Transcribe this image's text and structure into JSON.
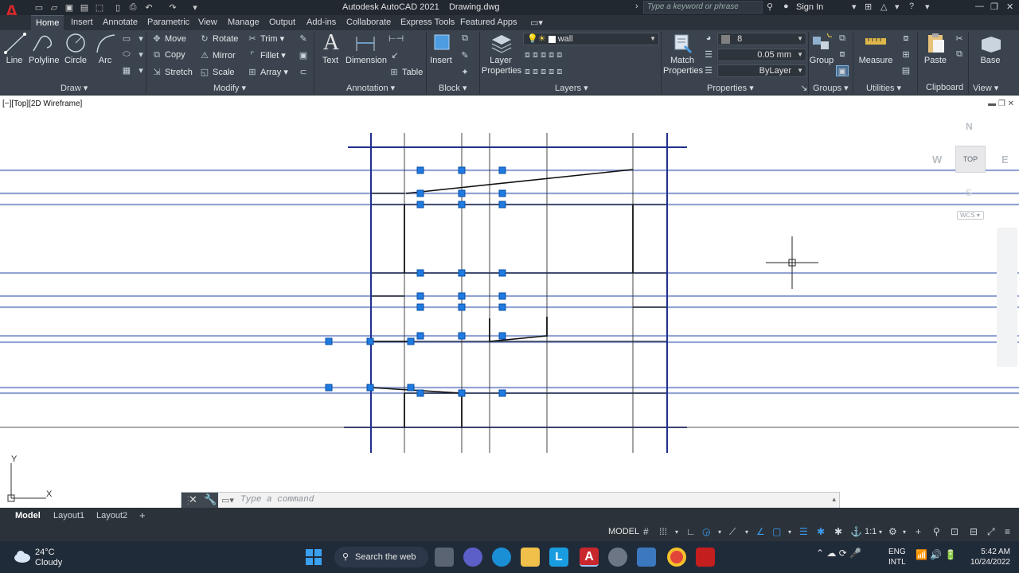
{
  "titlebar": {
    "title": "Autodesk AutoCAD 2021",
    "file": "Drawing.dwg",
    "search_placeholder": "Type a keyword or phrase",
    "signin": "Sign In"
  },
  "tabs": [
    "Home",
    "Insert",
    "Annotate",
    "Parametric",
    "View",
    "Manage",
    "Output",
    "Add-ins",
    "Collaborate",
    "Express Tools",
    "Featured Apps"
  ],
  "ribbon": {
    "draw": {
      "line": "Line",
      "polyline": "Polyline",
      "circle": "Circle",
      "arc": "Arc",
      "panel": "Draw"
    },
    "modify": {
      "move": "Move",
      "rotate": "Rotate",
      "trim": "Trim",
      "copy": "Copy",
      "mirror": "Mirror",
      "fillet": "Fillet",
      "stretch": "Stretch",
      "scale": "Scale",
      "array": "Array",
      "panel": "Modify"
    },
    "annotation": {
      "text": "Text",
      "dimension": "Dimension",
      "table": "Table",
      "panel": "Annotation"
    },
    "block": {
      "insert": "Insert",
      "panel": "Block"
    },
    "layers": {
      "layer_properties": "Layer Properties",
      "current_layer": "wall",
      "panel": "Layers"
    },
    "properties": {
      "match": "Match Properties",
      "color": "8",
      "lineweight": "0.05 mm",
      "linetype": "ByLayer",
      "panel": "Properties"
    },
    "groups": {
      "group": "Group",
      "panel": "Groups"
    },
    "utilities": {
      "measure": "Measure",
      "panel": "Utilities"
    },
    "clipboard": {
      "paste": "Paste",
      "panel": "Clipboard"
    },
    "view": {
      "base": "Base",
      "panel": "View"
    }
  },
  "viewport": {
    "label": "[−][Top][2D Wireframe]",
    "cube": {
      "n": "N",
      "s": "S",
      "e": "E",
      "w": "W",
      "top": "TOP",
      "wcs": "WCS"
    },
    "ucs": {
      "x": "X",
      "y": "Y"
    }
  },
  "command": {
    "placeholder": "Type a command"
  },
  "layouts": {
    "model": "Model",
    "layout1": "Layout1",
    "layout2": "Layout2",
    "add": "+"
  },
  "status": {
    "model": "MODEL",
    "scale": "1:1"
  },
  "taskbar": {
    "temp": "24°C",
    "weather": "Cloudy",
    "search": "Search the web",
    "lang1": "ENG",
    "lang2": "INTL",
    "time": "5:42 AM",
    "date": "10/24/2022"
  },
  "colors": {
    "accent": "#1e6fd9",
    "grip": "#1f7be0",
    "xline": "#93a4d4",
    "gridline": "#1f2f8f"
  }
}
